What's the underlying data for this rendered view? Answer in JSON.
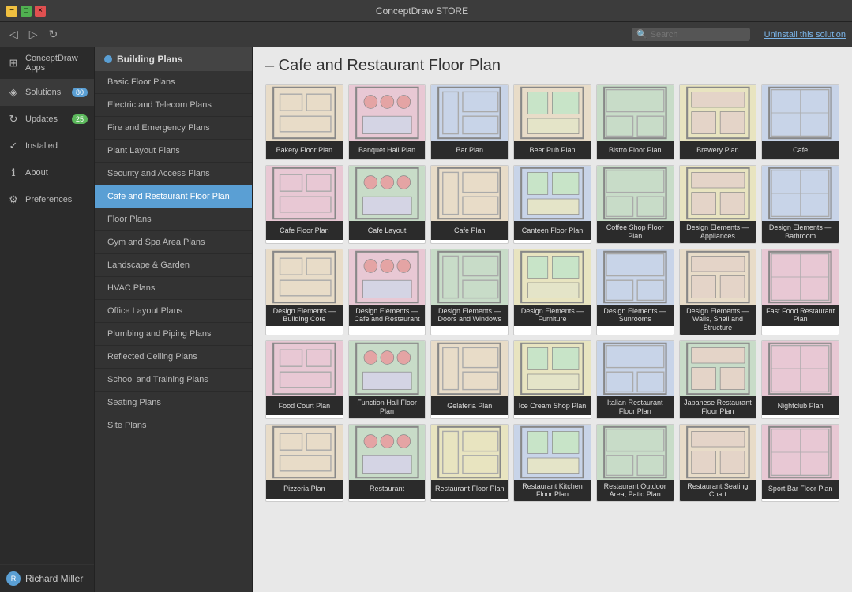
{
  "titleBar": {
    "title": "ConceptDraw STORE",
    "minimizeLabel": "−",
    "maximizeLabel": "□",
    "closeLabel": "×"
  },
  "toolbar": {
    "searchPlaceholder": "Search",
    "uninstallLink": "Uninstall this solution"
  },
  "sidebar": {
    "items": [
      {
        "id": "apps",
        "label": "ConceptDraw Apps",
        "icon": "⊞"
      },
      {
        "id": "solutions",
        "label": "Solutions",
        "icon": "◈",
        "badge": "80",
        "badgeColor": "blue",
        "active": true
      },
      {
        "id": "updates",
        "label": "Updates",
        "icon": "↻",
        "badge": "25",
        "badgeColor": "green"
      },
      {
        "id": "installed",
        "label": "Installed",
        "icon": "✓"
      },
      {
        "id": "about",
        "label": "About",
        "icon": "ℹ"
      },
      {
        "id": "preferences",
        "label": "Preferences",
        "icon": "⚙"
      }
    ],
    "user": {
      "name": "Richard Miller",
      "avatarInitial": "R"
    }
  },
  "navPanel": {
    "header": "Building Plans",
    "items": [
      {
        "label": "Basic Floor Plans"
      },
      {
        "label": "Electric and Telecom Plans"
      },
      {
        "label": "Fire and Emergency Plans"
      },
      {
        "label": "Plant Layout Plans"
      },
      {
        "label": "Security and Access Plans"
      },
      {
        "label": "Cafe and Restaurant Floor Plan",
        "active": true
      },
      {
        "label": "Floor Plans"
      },
      {
        "label": "Gym and Spa Area Plans"
      },
      {
        "label": "Landscape & Garden"
      },
      {
        "label": "HVAC Plans"
      },
      {
        "label": "Office Layout Plans"
      },
      {
        "label": "Plumbing and Piping Plans"
      },
      {
        "label": "Reflected Ceiling Plans"
      },
      {
        "label": "School and Training Plans"
      },
      {
        "label": "Seating Plans"
      },
      {
        "label": "Site Plans"
      }
    ]
  },
  "content": {
    "title": "– Cafe and Restaurant Floor Plan",
    "gridItems": [
      {
        "label": "Bakery Floor Plan",
        "thumbClass": "thumb-beige"
      },
      {
        "label": "Banquet Hall Plan",
        "thumbClass": "thumb-pink"
      },
      {
        "label": "Bar Plan",
        "thumbClass": "thumb-blue"
      },
      {
        "label": "Beer Pub Plan",
        "thumbClass": "thumb-beige"
      },
      {
        "label": "Bistro Floor Plan",
        "thumbClass": "thumb-green"
      },
      {
        "label": "Brewery Plan",
        "thumbClass": "thumb-yellow"
      },
      {
        "label": "Cafe",
        "thumbClass": "thumb-blue"
      },
      {
        "label": "Cafe Floor Plan",
        "thumbClass": "thumb-pink"
      },
      {
        "label": "Cafe Layout",
        "thumbClass": "thumb-green"
      },
      {
        "label": "Cafe Plan",
        "thumbClass": "thumb-beige"
      },
      {
        "label": "Canteen Floor Plan",
        "thumbClass": "thumb-blue"
      },
      {
        "label": "Coffee Shop Floor Plan",
        "thumbClass": "thumb-green"
      },
      {
        "label": "Design Elements — Appliances",
        "thumbClass": "thumb-yellow"
      },
      {
        "label": "Design Elements — Bathroom",
        "thumbClass": "thumb-blue"
      },
      {
        "label": "Design Elements — Building Core",
        "thumbClass": "thumb-beige"
      },
      {
        "label": "Design Elements — Cafe and Restaurant",
        "thumbClass": "thumb-pink"
      },
      {
        "label": "Design Elements — Doors and Windows",
        "thumbClass": "thumb-green"
      },
      {
        "label": "Design Elements — Furniture",
        "thumbClass": "thumb-yellow"
      },
      {
        "label": "Design Elements — Sunrooms",
        "thumbClass": "thumb-blue"
      },
      {
        "label": "Design Elements — Walls, Shell and Structure",
        "thumbClass": "thumb-beige"
      },
      {
        "label": "Fast Food Restaurant Plan",
        "thumbClass": "thumb-pink"
      },
      {
        "label": "Food Court Plan",
        "thumbClass": "thumb-pink"
      },
      {
        "label": "Function Hall Floor Plan",
        "thumbClass": "thumb-green"
      },
      {
        "label": "Gelateria Plan",
        "thumbClass": "thumb-beige"
      },
      {
        "label": "Ice Cream Shop Plan",
        "thumbClass": "thumb-yellow"
      },
      {
        "label": "Italian Restaurant Floor Plan",
        "thumbClass": "thumb-blue"
      },
      {
        "label": "Japanese Restaurant Floor Plan",
        "thumbClass": "thumb-green"
      },
      {
        "label": "Nightclub Plan",
        "thumbClass": "thumb-pink"
      },
      {
        "label": "Pizzeria Plan",
        "thumbClass": "thumb-beige"
      },
      {
        "label": "Restaurant",
        "thumbClass": "thumb-green"
      },
      {
        "label": "Restaurant Floor Plan",
        "thumbClass": "thumb-yellow"
      },
      {
        "label": "Restaurant Kitchen Floor Plan",
        "thumbClass": "thumb-blue"
      },
      {
        "label": "Restaurant Outdoor Area, Patio Plan",
        "thumbClass": "thumb-green"
      },
      {
        "label": "Restaurant Seating Chart",
        "thumbClass": "thumb-beige"
      },
      {
        "label": "Sport Bar Floor Plan",
        "thumbClass": "thumb-pink"
      }
    ]
  }
}
